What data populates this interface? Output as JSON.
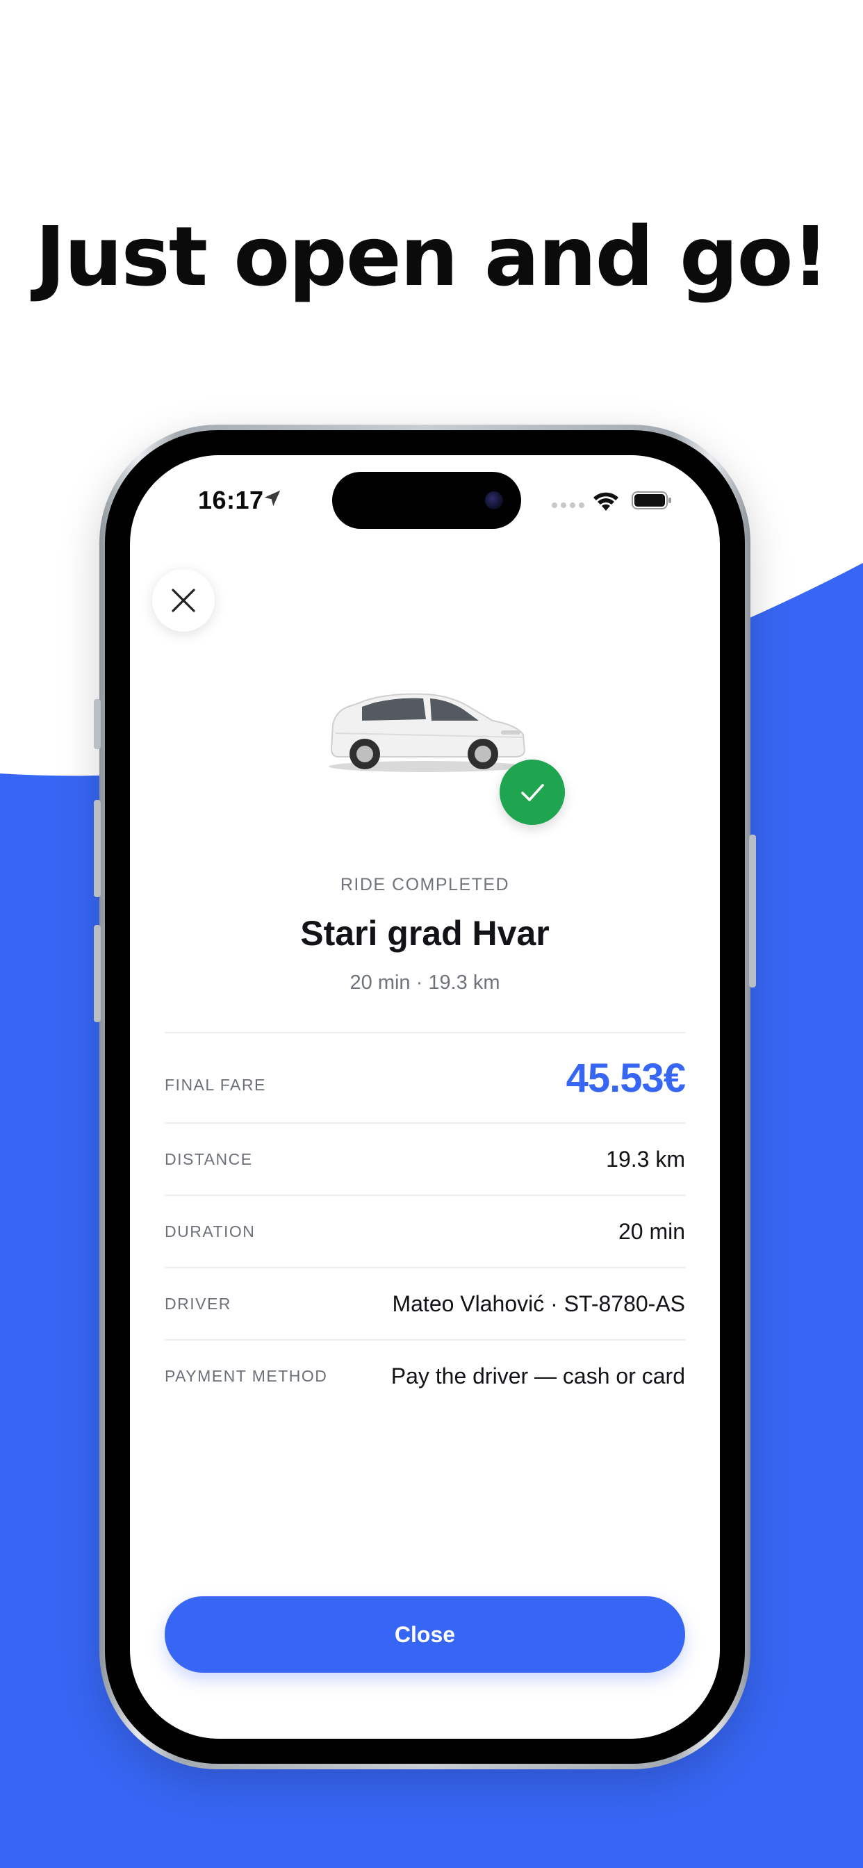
{
  "headline": "Just open and go!",
  "status_bar": {
    "time": "16:17"
  },
  "ride": {
    "status": "RIDE COMPLETED",
    "destination": "Stari grad Hvar",
    "summary": "20 min · 19.3 km"
  },
  "details": [
    {
      "label": "FINAL FARE",
      "value": "45.53€"
    },
    {
      "label": "DISTANCE",
      "value": "19.3 km"
    },
    {
      "label": "DURATION",
      "value": "20 min"
    },
    {
      "label": "DRIVER",
      "value": "Mateo Vlahović · ST-8780-AS"
    },
    {
      "label": "PAYMENT METHOD",
      "value": "Pay the driver — cash or card"
    }
  ],
  "close_button": "Close",
  "colors": {
    "brand_blue": "#3766f4",
    "success_green": "#1fa54f"
  },
  "icons": {
    "close": "close-icon",
    "check": "checkmark-icon",
    "location": "location-arrow-icon",
    "wifi": "wifi-icon",
    "battery": "battery-icon"
  }
}
